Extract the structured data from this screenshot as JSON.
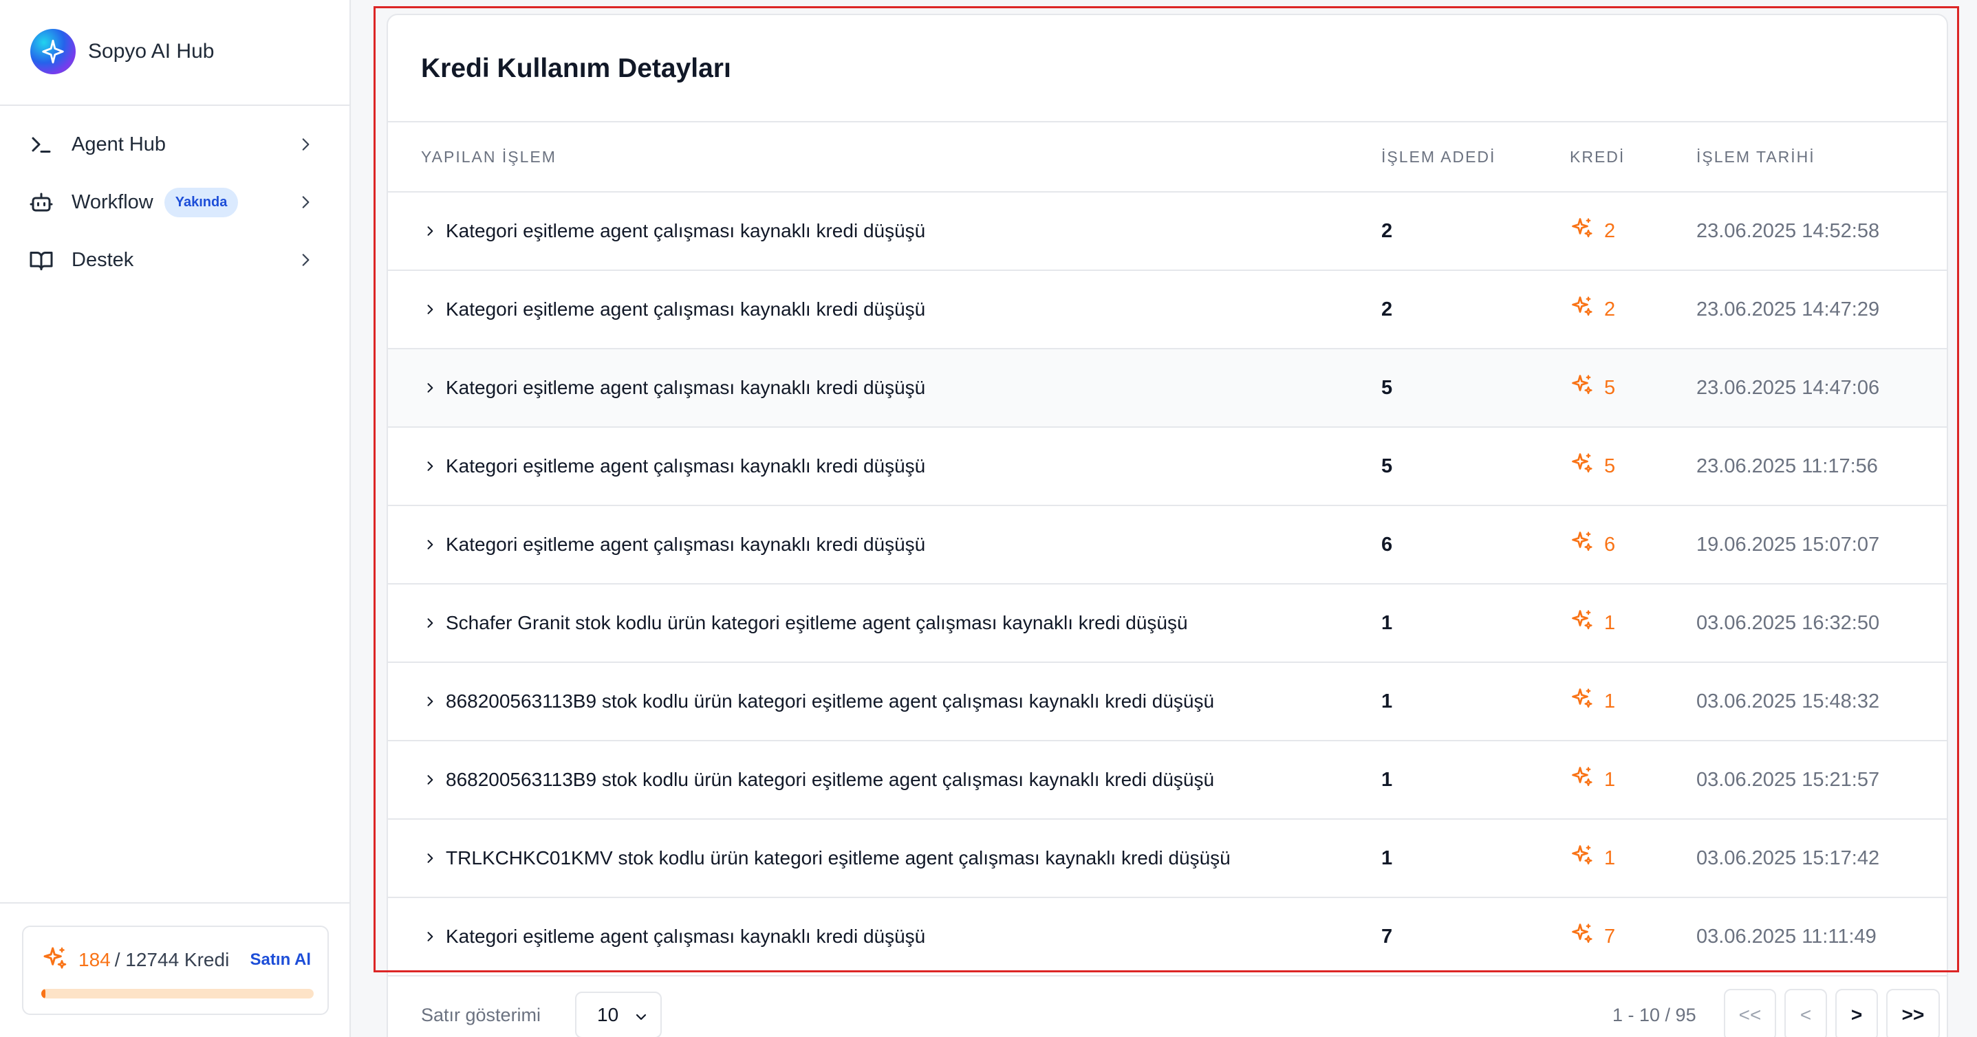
{
  "brand": {
    "name": "Sopyo AI Hub"
  },
  "nav": [
    {
      "label": "Agent Hub",
      "icon": "terminal-icon",
      "badge": ""
    },
    {
      "label": "Workflow",
      "icon": "bot-icon",
      "badge": "Yakında"
    },
    {
      "label": "Destek",
      "icon": "book-open-icon",
      "badge": ""
    }
  ],
  "credits": {
    "used": "184",
    "total": "/ 12744 Kredi",
    "buy_label": "Satın Al",
    "usage_fraction": 0.0144
  },
  "table": {
    "title": "Kredi Kullanım Detayları",
    "headers": {
      "desc": "YAPILAN İŞLEM",
      "count": "İŞLEM ADEDİ",
      "credit": "KREDİ",
      "date": "İŞLEM TARİHİ"
    },
    "rows": [
      {
        "desc": "Kategori eşitleme agent çalışması kaynaklı kredi düşüşü",
        "count": "2",
        "credit": "2",
        "date": "23.06.2025 14:52:58"
      },
      {
        "desc": "Kategori eşitleme agent çalışması kaynaklı kredi düşüşü",
        "count": "2",
        "credit": "2",
        "date": "23.06.2025 14:47:29"
      },
      {
        "desc": "Kategori eşitleme agent çalışması kaynaklı kredi düşüşü",
        "count": "5",
        "credit": "5",
        "date": "23.06.2025 14:47:06"
      },
      {
        "desc": "Kategori eşitleme agent çalışması kaynaklı kredi düşüşü",
        "count": "5",
        "credit": "5",
        "date": "23.06.2025 11:17:56"
      },
      {
        "desc": "Kategori eşitleme agent çalışması kaynaklı kredi düşüşü",
        "count": "6",
        "credit": "6",
        "date": "19.06.2025 15:07:07"
      },
      {
        "desc": "Schafer Granit stok kodlu ürün kategori eşitleme agent çalışması kaynaklı kredi düşüşü",
        "count": "1",
        "credit": "1",
        "date": "03.06.2025 16:32:50"
      },
      {
        "desc": "868200563113B9 stok kodlu ürün kategori eşitleme agent çalışması kaynaklı kredi düşüşü",
        "count": "1",
        "credit": "1",
        "date": "03.06.2025 15:48:32"
      },
      {
        "desc": "868200563113B9 stok kodlu ürün kategori eşitleme agent çalışması kaynaklı kredi düşüşü",
        "count": "1",
        "credit": "1",
        "date": "03.06.2025 15:21:57"
      },
      {
        "desc": "TRLKCHKC01KMV stok kodlu ürün kategori eşitleme agent çalışması kaynaklı kredi düşüşü",
        "count": "1",
        "credit": "1",
        "date": "03.06.2025 15:17:42"
      },
      {
        "desc": "Kategori eşitleme agent çalışması kaynaklı kredi düşüşü",
        "count": "7",
        "credit": "7",
        "date": "03.06.2025 11:11:49"
      }
    ],
    "highlighted_row_index": 2
  },
  "pagination": {
    "rows_label": "Satır gösterimi",
    "page_size": "10",
    "page_info": "1 - 10 / 95",
    "first_label": "<<",
    "prev_label": "<",
    "next_label": ">",
    "last_label": ">>"
  },
  "colors": {
    "accent_orange": "#f97316",
    "link_blue": "#1d4ed8",
    "highlight_red": "#dc2626"
  }
}
